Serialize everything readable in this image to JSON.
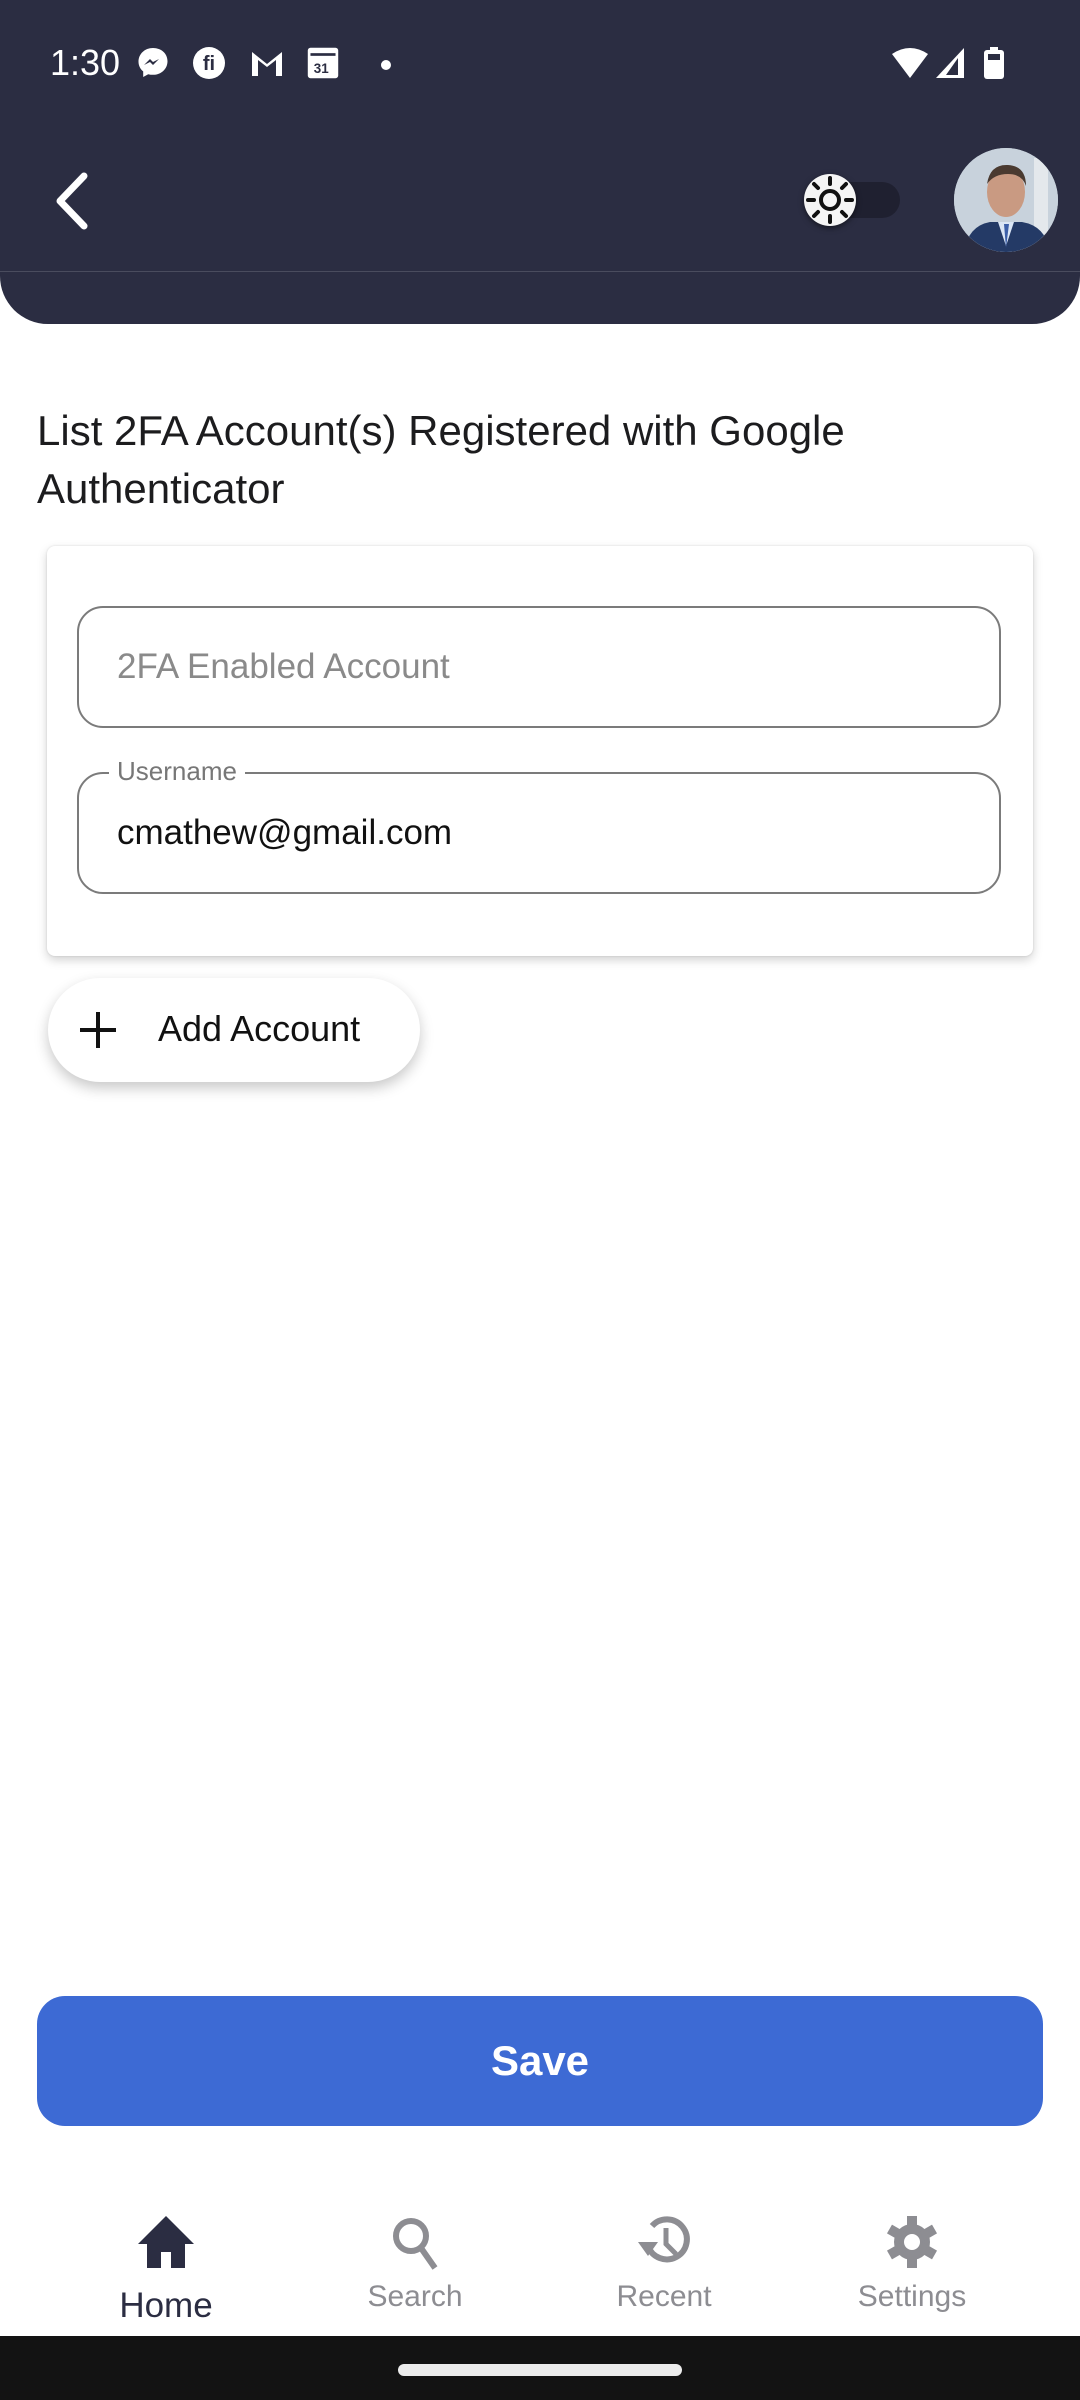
{
  "status_bar": {
    "time": "1:30",
    "notification_icons": [
      "messenger-icon",
      "fi-app-icon",
      "gmail-icon",
      "calendar-icon",
      "more-dot-icon"
    ],
    "calendar_day": "31",
    "system_icons": [
      "wifi-icon",
      "signal-icon",
      "battery-icon"
    ]
  },
  "header": {
    "back_icon": "chevron-left-icon",
    "theme_toggle": {
      "state": "off",
      "icon": "sun-icon"
    },
    "avatar_alt": "User profile photo"
  },
  "page": {
    "title": "List 2FA Account(s) Registered with Google Authenticator"
  },
  "form": {
    "account_field": {
      "placeholder": "2FA Enabled Account",
      "value": ""
    },
    "username_field": {
      "label": "Username",
      "value": "cmathew@gmail.com"
    }
  },
  "actions": {
    "add_account_label": "Add Account",
    "save_label": "Save"
  },
  "bottom_nav": {
    "items": [
      {
        "label": "Home",
        "icon": "home-icon",
        "active": true
      },
      {
        "label": "Search",
        "icon": "search-icon",
        "active": false
      },
      {
        "label": "Recent",
        "icon": "history-icon",
        "active": false
      },
      {
        "label": "Settings",
        "icon": "gear-icon",
        "active": false
      }
    ]
  },
  "colors": {
    "header_bg": "#2b2d42",
    "primary": "#3d6ad4",
    "nav_active": "#2b2d42",
    "nav_inactive": "#8d8d92"
  }
}
